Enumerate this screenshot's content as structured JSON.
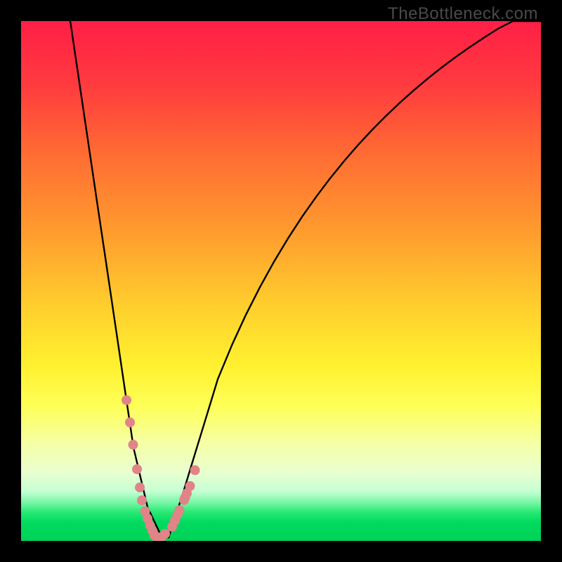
{
  "watermark": "TheBottleneck.com",
  "colors": {
    "black": "#000000",
    "curve_stroke": "#000000",
    "marker_fill": "#e08488",
    "gradient_stops": [
      {
        "offset": 0.0,
        "color": "#ff1f46"
      },
      {
        "offset": 0.12,
        "color": "#ff3a3f"
      },
      {
        "offset": 0.25,
        "color": "#ff6a33"
      },
      {
        "offset": 0.4,
        "color": "#ff9a2e"
      },
      {
        "offset": 0.55,
        "color": "#ffcf2d"
      },
      {
        "offset": 0.66,
        "color": "#fff02f"
      },
      {
        "offset": 0.74,
        "color": "#feff56"
      },
      {
        "offset": 0.81,
        "color": "#f6ffa4"
      },
      {
        "offset": 0.87,
        "color": "#e8ffd0"
      },
      {
        "offset": 0.905,
        "color": "#c4ffd3"
      },
      {
        "offset": 0.925,
        "color": "#7cf7a8"
      },
      {
        "offset": 0.945,
        "color": "#26e873"
      },
      {
        "offset": 0.965,
        "color": "#00da5e"
      },
      {
        "offset": 1.0,
        "color": "#00d257"
      }
    ]
  },
  "chart_data": {
    "type": "line",
    "title": "",
    "xlabel": "",
    "ylabel": "",
    "xlim": [
      0,
      100
    ],
    "ylim": [
      0,
      100
    ],
    "grid": false,
    "legend": false,
    "x": [
      9.46,
      10.81,
      12.16,
      13.51,
      14.86,
      16.22,
      17.57,
      18.92,
      20.27,
      20.95,
      21.62,
      22.3,
      22.97,
      23.65,
      24.32,
      25.68,
      27.03,
      28.38,
      29.05,
      29.73,
      30.41,
      31.08,
      31.76,
      32.43,
      33.78,
      35.14,
      36.49,
      37.84,
      40.54,
      43.24,
      45.95,
      48.65,
      51.35,
      54.05,
      56.76,
      59.46,
      62.16,
      64.86,
      67.57,
      70.27,
      72.97,
      75.68,
      78.38,
      81.08,
      83.78,
      86.49,
      89.19,
      91.89,
      94.59,
      97.3,
      100.0
    ],
    "y": [
      100.0,
      90.89,
      81.77,
      72.66,
      63.54,
      54.43,
      45.31,
      36.2,
      27.08,
      22.53,
      17.97,
      15.1,
      12.24,
      9.38,
      6.51,
      3.65,
      0.78,
      0.65,
      2.73,
      4.82,
      6.9,
      8.98,
      11.2,
      13.41,
      17.84,
      22.27,
      26.69,
      31.12,
      37.63,
      43.49,
      48.83,
      53.71,
      58.2,
      62.35,
      66.19,
      69.77,
      73.09,
      76.2,
      79.11,
      81.83,
      84.39,
      86.8,
      89.06,
      91.2,
      93.21,
      95.11,
      96.91,
      98.61,
      100.0,
      100.0,
      100.0
    ],
    "markers_x": [
      20.27,
      20.95,
      21.55,
      22.3,
      22.84,
      23.24,
      23.85,
      24.32,
      24.8,
      25.27,
      25.68,
      26.01,
      26.42,
      27.03,
      27.7,
      29.05,
      29.59,
      30.07,
      30.47,
      31.35,
      31.55,
      31.89,
      32.5,
      33.45
    ],
    "markers_y": [
      27.08,
      22.8,
      18.51,
      13.8,
      10.29,
      7.81,
      5.73,
      4.3,
      3.0,
      1.95,
      1.04,
      0.72,
      0.52,
      0.78,
      1.37,
      2.73,
      3.91,
      5.01,
      5.92,
      7.88,
      8.33,
      9.18,
      10.55,
      13.61
    ]
  }
}
